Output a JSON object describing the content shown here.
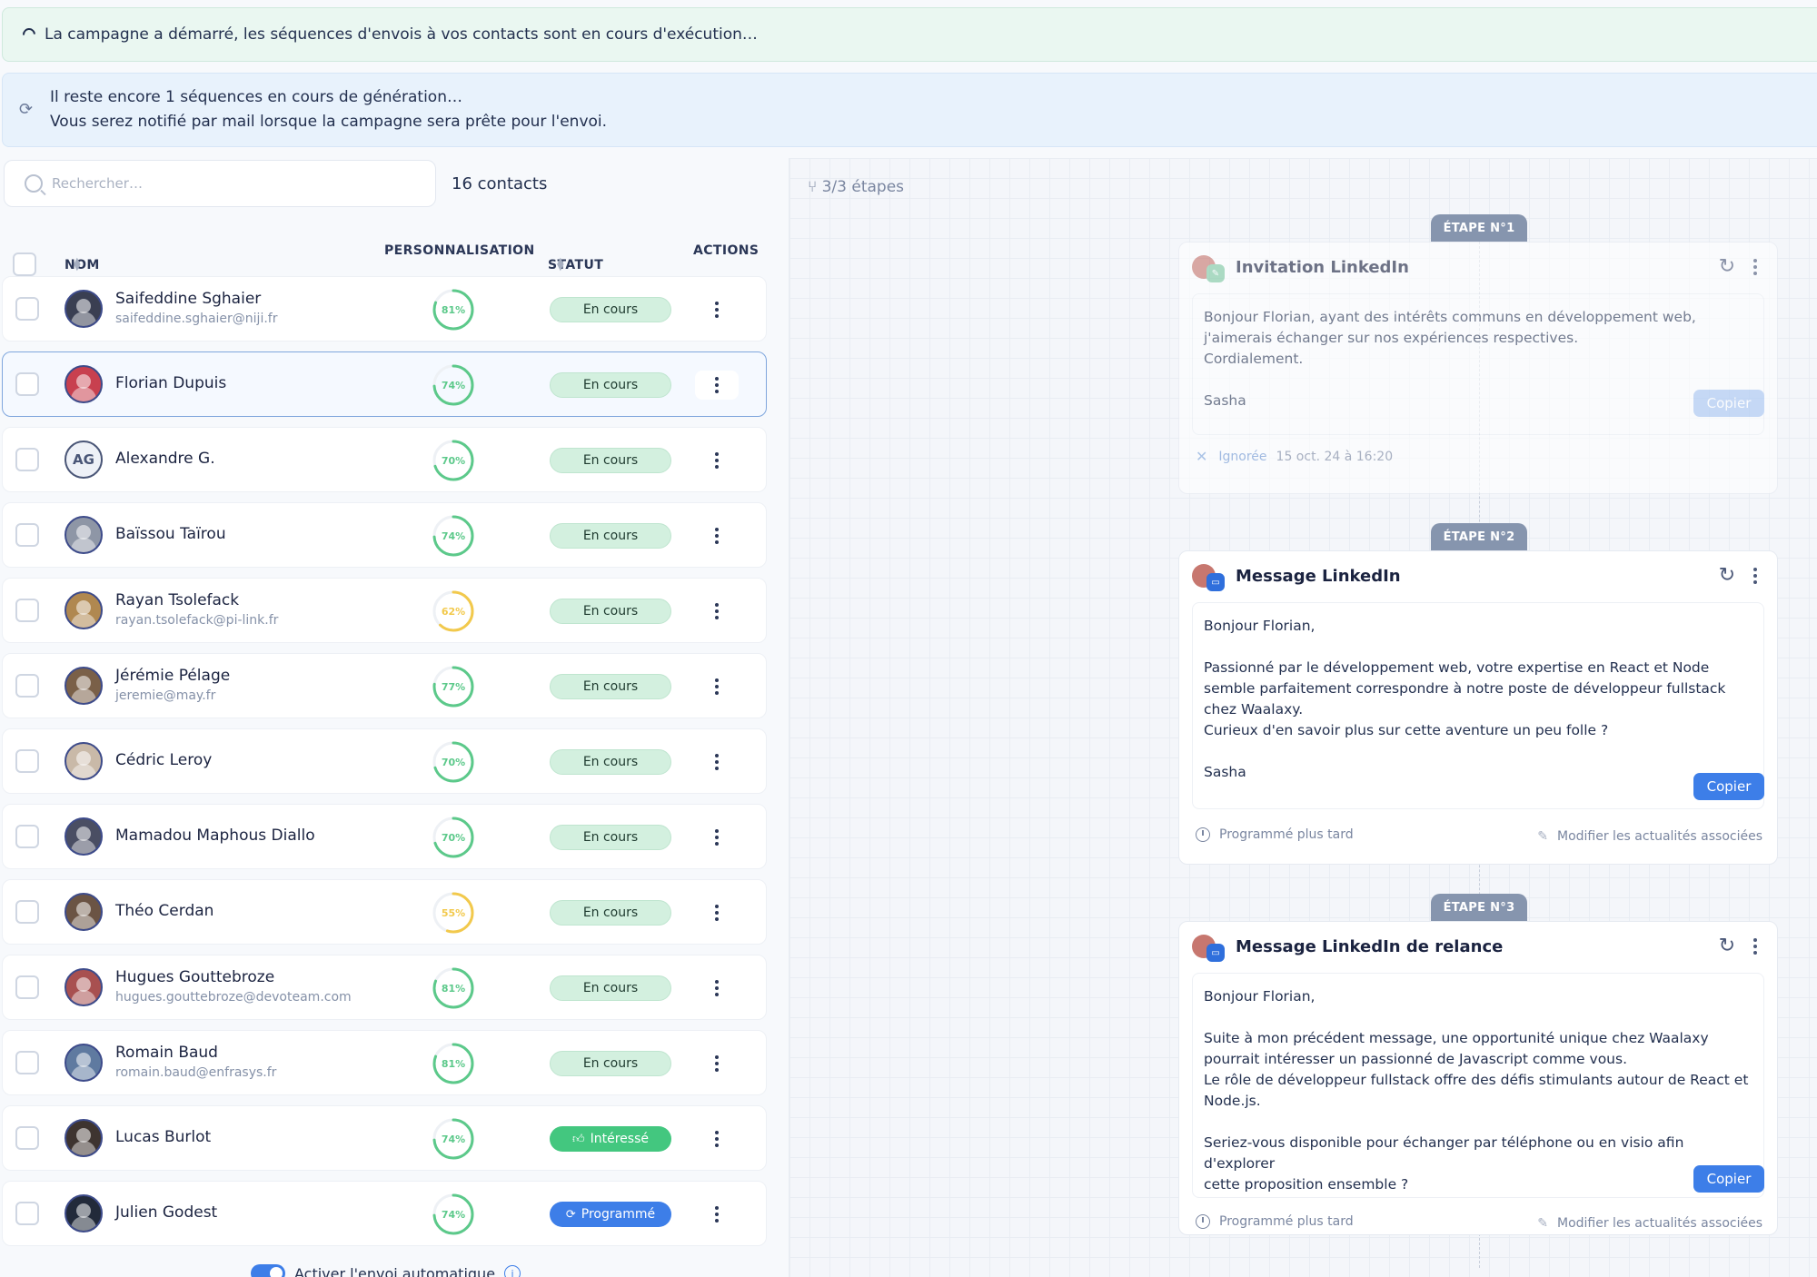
{
  "banners": {
    "started": "La campagne a démarré, les séquences d'envois à vos contacts sont en cours d'exécution…",
    "generating_line1": "Il reste encore 1 séquences en cours de génération…",
    "generating_line2": "Vous serez notifié par mail lorsque la campagne sera prête pour l'envoi."
  },
  "search": {
    "placeholder": "Rechercher…"
  },
  "contacts_count": "16 contacts",
  "table": {
    "headers": {
      "name": "NOM",
      "personalization": "PERSONNALISATION",
      "status": "STATUT",
      "actions": "ACTIONS"
    },
    "rows": [
      {
        "name": "Saifeddine Sghaier",
        "email": "saifeddine.sghaier@niji.fr",
        "score": "81%",
        "score_value": 81,
        "status": "En cours",
        "status_type": "cours",
        "avatar_color": "#3a3f52"
      },
      {
        "name": "Florian Dupuis",
        "email": "",
        "score": "74%",
        "score_value": 74,
        "status": "En cours",
        "status_type": "cours",
        "avatar_color": "#c8404f",
        "selected": true
      },
      {
        "name": "Alexandre G.",
        "email": "",
        "score": "70%",
        "score_value": 70,
        "status": "En cours",
        "status_type": "cours",
        "initials": "AG"
      },
      {
        "name": "Baïssou Taïrou",
        "email": "",
        "score": "74%",
        "score_value": 74,
        "status": "En cours",
        "status_type": "cours",
        "avatar_color": "#8e96a6"
      },
      {
        "name": "Rayan Tsolefack",
        "email": "rayan.tsolefack@pi-link.fr",
        "score": "62%",
        "score_value": 62,
        "status": "En cours",
        "status_type": "cours",
        "avatar_color": "#b08850"
      },
      {
        "name": "Jérémie Pélage",
        "email": "jeremie@may.fr",
        "score": "77%",
        "score_value": 77,
        "status": "En cours",
        "status_type": "cours",
        "avatar_color": "#7a6048"
      },
      {
        "name": "Cédric Leroy",
        "email": "",
        "score": "70%",
        "score_value": 70,
        "status": "En cours",
        "status_type": "cours",
        "avatar_color": "#c9b9a8"
      },
      {
        "name": "Mamadou Maphous Diallo",
        "email": "",
        "score": "70%",
        "score_value": 70,
        "status": "En cours",
        "status_type": "cours",
        "avatar_color": "#4a4e63"
      },
      {
        "name": "Théo Cerdan",
        "email": "",
        "score": "55%",
        "score_value": 55,
        "status": "En cours",
        "status_type": "cours",
        "avatar_color": "#6b5444"
      },
      {
        "name": "Hugues Gouttebroze",
        "email": "hugues.gouttebroze@devoteam.com",
        "score": "81%",
        "score_value": 81,
        "status": "En cours",
        "status_type": "cours",
        "avatar_color": "#a85050"
      },
      {
        "name": "Romain Baud",
        "email": "romain.baud@enfrasys.fr",
        "score": "81%",
        "score_value": 81,
        "status": "En cours",
        "status_type": "cours",
        "avatar_color": "#5f7aa0"
      },
      {
        "name": "Lucas Burlot",
        "email": "",
        "score": "74%",
        "score_value": 74,
        "status": "Intéressé",
        "status_type": "interesse",
        "avatar_color": "#3e3430"
      },
      {
        "name": "Julien Godest",
        "email": "",
        "score": "74%",
        "score_value": 74,
        "status": "Programmé",
        "status_type": "programme",
        "avatar_color": "#222a3a"
      }
    ]
  },
  "auto_send_label": "Activer l'envoi automatique",
  "steps_count": "3/3 étapes",
  "steps": [
    {
      "tab": "ÉTAPE N°1",
      "title": "Invitation LinkedIn",
      "badge": "invite",
      "message": "Bonjour Florian, ayant des intérêts communs en développement web,\nj'aimerais échanger sur nos expériences respectives.\nCordialement.\n\nSasha",
      "copy": "Copier",
      "footer_status": "Ignorée",
      "footer_date": "15 oct. 24 à 16:20"
    },
    {
      "tab": "ÉTAPE N°2",
      "title": "Message LinkedIn",
      "badge": "msg",
      "message": "Bonjour Florian,\n\nPassionné par le développement web, votre expertise en React et Node\nsemble parfaitement correspondre à notre poste de développeur fullstack\nchez Waalaxy.\nCurieux d'en savoir plus sur cette aventure un peu folle ?\n\nSasha",
      "copy": "Copier",
      "footer_left": "Programmé plus tard",
      "footer_right": "Modifier les actualités associées"
    },
    {
      "tab": "ÉTAPE N°3",
      "title": "Message LinkedIn de relance",
      "badge": "msg",
      "message": "Bonjour Florian,\n\nSuite à mon précédent message, une opportunité unique chez Waalaxy\npourrait intéresser un passionné de Javascript comme vous.\nLe rôle de développeur fullstack offre des défis stimulants autour de React et\nNode.js.\n\nSeriez-vous disponible pour échanger par téléphone ou en visio afin d'explorer\ncette proposition ensemble ?",
      "copy": "Copier",
      "footer_left": "Programmé plus tard",
      "footer_right": "Modifier les actualités associées"
    }
  ],
  "colors": {
    "accent": "#3d7ee8",
    "success": "#43c77f",
    "gauge_high": "#5cc98a",
    "gauge_mid": "#f2c94c"
  }
}
